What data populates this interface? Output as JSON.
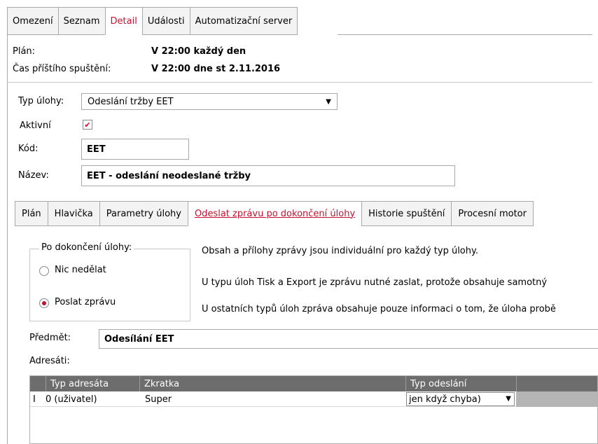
{
  "top_tabs": [
    {
      "label": "Omezení"
    },
    {
      "label": "Seznam"
    },
    {
      "label": "Detail"
    },
    {
      "label": "Události"
    },
    {
      "label": "Automatizační server"
    }
  ],
  "info": {
    "plan_label": "Plán:",
    "plan_value": "V 22:00 každý den",
    "next_label": "Čas příštího spuštění:",
    "next_value": "V 22:00 dne st 2.11.2016"
  },
  "form": {
    "type_label": "Typ úlohy:",
    "type_value": "Odeslání tržby EET",
    "active_label": "Aktivní",
    "active_checked": "✔",
    "code_label": "Kód:",
    "code_value": "EET",
    "name_label": "Název:",
    "name_value": "EET - odeslání neodeslané tržby"
  },
  "inner_tabs": [
    {
      "label": "Plán"
    },
    {
      "label": "Hlavička"
    },
    {
      "label": "Parametry úlohy"
    },
    {
      "label": "Odeslat zprávu po dokončení úlohy"
    },
    {
      "label": "Historie spuštění"
    },
    {
      "label": "Procesní motor"
    }
  ],
  "completion": {
    "group_title": "Po dokončení úlohy:",
    "option_nothing": "Nic nedělat",
    "option_send": "Poslat zprávu",
    "selected": "Poslat zprávu"
  },
  "info_texts": [
    "Obsah a přílohy zprávy jsou individuální pro každý typ úlohy.",
    "U typu úloh Tisk a Export je zprávu nutné zaslat, protože obsahuje samotný",
    "U ostatních typů úloh zpráva obsahuje pouze informaci o tom, že úloha probě"
  ],
  "message": {
    "subject_label": "Předmět:",
    "subject_value": "Odesílání EET",
    "recipients_label": "Adresáti:"
  },
  "recipients_table": {
    "columns": [
      "Typ adresáta",
      "Zkratka",
      "Typ odeslání"
    ],
    "rows": [
      {
        "marker": "I",
        "type": "0 (uživatel)",
        "short": "Super",
        "send_type": "jen když chyba)"
      }
    ]
  }
}
